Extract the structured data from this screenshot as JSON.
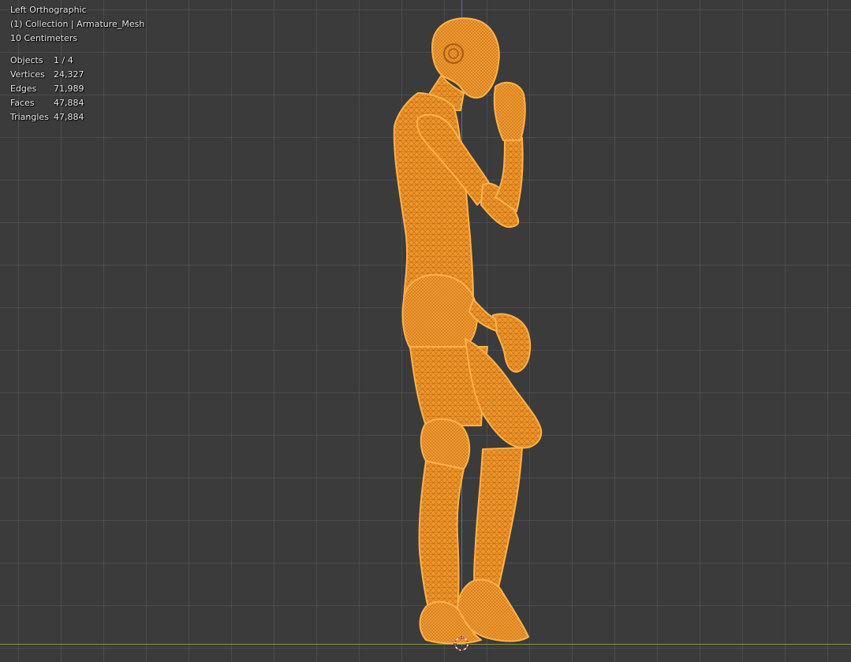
{
  "viewport": {
    "view_name": "Left Orthographic",
    "collection_line": "(1) Collection | Armature_Mesh",
    "scale_line": "10 Centimeters",
    "stats": [
      {
        "label": "Objects",
        "value": "1 / 4"
      },
      {
        "label": "Vertices",
        "value": "24,327"
      },
      {
        "label": "Edges",
        "value": "71,989"
      },
      {
        "label": "Faces",
        "value": "47,884"
      },
      {
        "label": "Triangles",
        "value": "47,884"
      }
    ],
    "colors": {
      "background": "#3b3b3b",
      "grid": "#5a5a5a",
      "selection_orange": "#f5a03a",
      "wire_dark": "#b3660f",
      "z_axis": "#4a73b3",
      "y_axis": "#7f9a3a"
    },
    "object": {
      "name": "Armature_Mesh",
      "display": "wireframe",
      "selected": true
    }
  }
}
